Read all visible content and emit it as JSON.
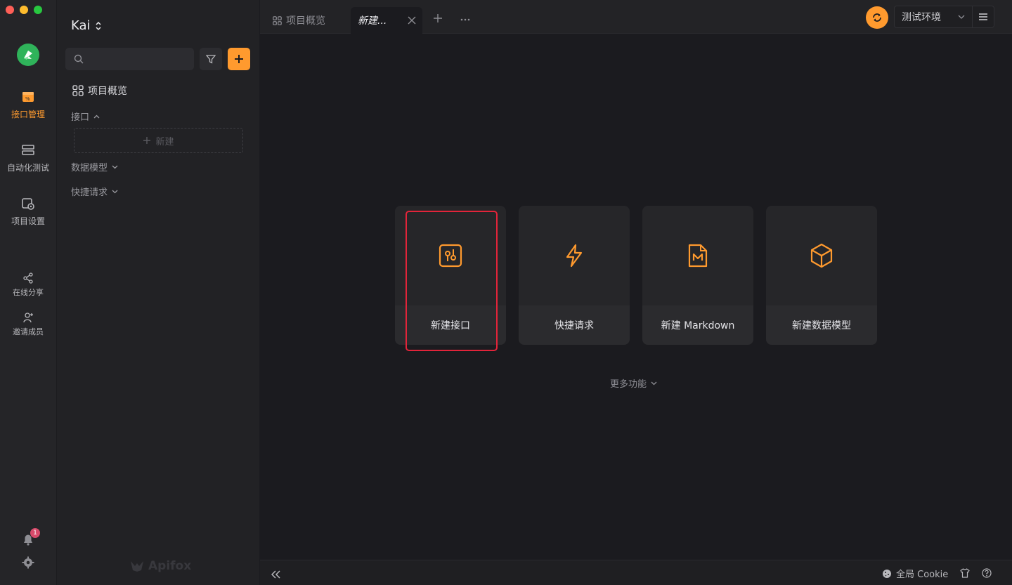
{
  "app": {
    "brand": "Apifox",
    "project_name": "Kai"
  },
  "rail": {
    "items": [
      {
        "label": "接口管理",
        "icon": "api-icon",
        "active": true
      },
      {
        "label": "自动化测试",
        "icon": "automation-icon",
        "active": false
      },
      {
        "label": "项目设置",
        "icon": "project-settings-icon",
        "active": false
      }
    ],
    "share_label": "在线分享",
    "invite_label": "邀请成员",
    "notification_count": "1"
  },
  "sidebar": {
    "search_placeholder": "",
    "overview_label": "项目概览",
    "sections": [
      {
        "label": "接口",
        "expanded": true
      },
      {
        "label": "数据模型",
        "expanded": false
      },
      {
        "label": "快捷请求",
        "expanded": false
      }
    ],
    "new_label": "新建"
  },
  "tabs": [
    {
      "label": "项目概览",
      "active": false
    },
    {
      "label": "新建...",
      "active": true
    }
  ],
  "environment": {
    "selected": "测试环境"
  },
  "cards": [
    {
      "label": "新建接口",
      "icon": "api-doc-icon",
      "highlighted": true
    },
    {
      "label": "快捷请求",
      "icon": "lightning-icon",
      "highlighted": false
    },
    {
      "label": "新建 Markdown",
      "icon": "markdown-icon",
      "highlighted": false
    },
    {
      "label": "新建数据模型",
      "icon": "cube-icon",
      "highlighted": false
    }
  ],
  "more_functions": "更多功能",
  "footer": {
    "cookie_label": "全局 Cookie"
  },
  "colors": {
    "accent": "#ff9a2e",
    "highlight": "#e2243a",
    "background": "#1b1b1f"
  }
}
